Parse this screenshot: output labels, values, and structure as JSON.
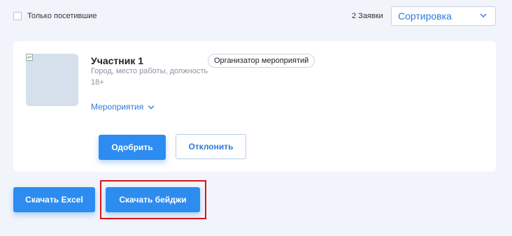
{
  "filters": {
    "only_visited_label": "Только посетившие",
    "applications_count": "2 Заявки",
    "sort_label": "Сортировка"
  },
  "participant": {
    "name": "Участник 1",
    "role": "Организатор мероприятий",
    "meta": "Город, место работы, должность",
    "age": "18+",
    "events_label": "Мероприятия"
  },
  "actions": {
    "approve": "Одобрить",
    "reject": "Отклонить"
  },
  "footer": {
    "download_excel": "Скачать Excel",
    "download_badges": "Скачать бейджи"
  },
  "colors": {
    "accent": "#2d8cf0",
    "link": "#2d7bdc",
    "background": "#f1f4fa",
    "highlight": "#e0111a"
  },
  "icons": {
    "sort_dropdown": "chevron-down-icon",
    "events_toggle": "chevron-down-icon",
    "photo": "broken-image-icon"
  }
}
